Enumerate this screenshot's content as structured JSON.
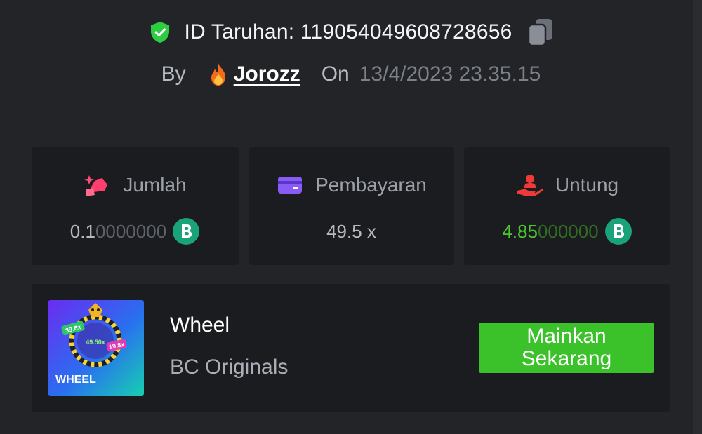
{
  "header": {
    "bet_id_text": "ID Taruhan: 119054049608728656",
    "by_label": "By",
    "username": "Jorozz",
    "on_label": "On",
    "datetime": "13/4/2023 23.35.15"
  },
  "stats": [
    {
      "label": "Jumlah",
      "value_main": "0.1",
      "value_trailing": "0000000",
      "icon": "bet-amount-icon",
      "has_coin": true
    },
    {
      "label": "Pembayaran",
      "value_main": "49.5 x",
      "value_trailing": "",
      "icon": "payout-card-icon",
      "has_coin": false
    },
    {
      "label": "Untung",
      "value_main": "4.85",
      "value_trailing": "000000",
      "icon": "profit-hand-icon",
      "has_coin": true
    }
  ],
  "game": {
    "title": "Wheel",
    "provider": "BC Originals",
    "thumb_label": "WHEEL",
    "thumb_tags": [
      "39.6x",
      "49.50x",
      "19.8x"
    ],
    "play_label": "Mainkan Sekarang"
  },
  "colors": {
    "background": "#232427",
    "card": "#1b1c1f",
    "accent_green": "#3bc22a",
    "profit_green": "#4cc62e",
    "shield_green": "#2ecc40",
    "coin_teal": "#1aa37a"
  }
}
